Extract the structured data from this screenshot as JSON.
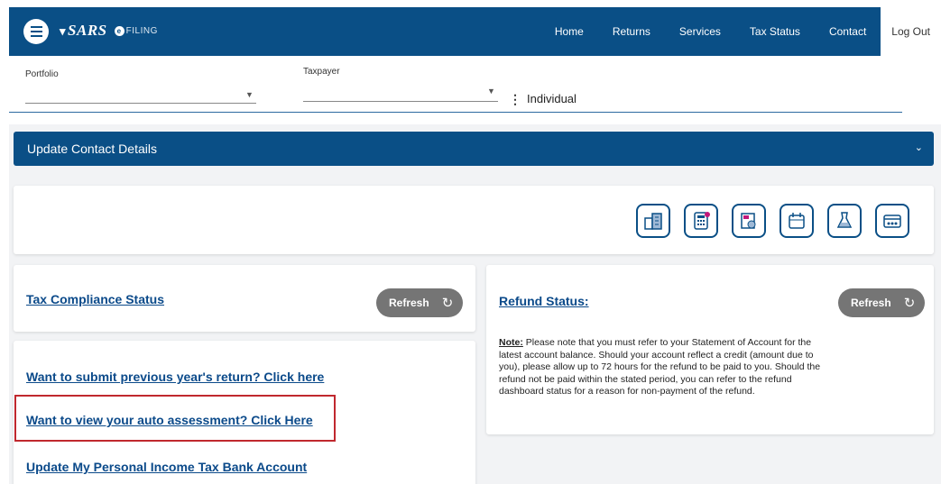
{
  "nav": {
    "brand": "SARS",
    "brand_sub": "FILING",
    "links": [
      "Home",
      "Returns",
      "Services",
      "Tax Status",
      "Contact"
    ],
    "logout": "Log Out"
  },
  "selectors": {
    "portfolio_label": "Portfolio",
    "taxpayer_label": "Taxpayer",
    "taxpayer_type": "Individual"
  },
  "update_contact": {
    "title": "Update Contact Details"
  },
  "tools": [
    "building-icon",
    "calculator-icon",
    "certificate-icon",
    "calendar-icon",
    "flask-icon",
    "payment-card-icon"
  ],
  "compliance": {
    "title": "Tax Compliance Status",
    "refresh": "Refresh"
  },
  "links": {
    "previous_year": "Want to submit previous year's return? Click here",
    "auto_assessment": "Want to view your auto assessment? Click Here",
    "bank_account": "Update My Personal Income Tax Bank Account"
  },
  "refund": {
    "title": "Refund Status:",
    "refresh": "Refresh",
    "note_label": "Note:",
    "note_text": " Please note that you must refer to your Statement of Account for the latest account balance. Should your account reflect a credit (amount due to you), please allow up to 72 hours for the refund to be paid to you. Should the refund not be paid within the stated period, you can refer to the refund dashboard status for a reason for non-payment of the refund."
  },
  "colors": {
    "brand": "#0a4f86",
    "highlight": "#c0282e",
    "refresh_bg": "#757575"
  }
}
